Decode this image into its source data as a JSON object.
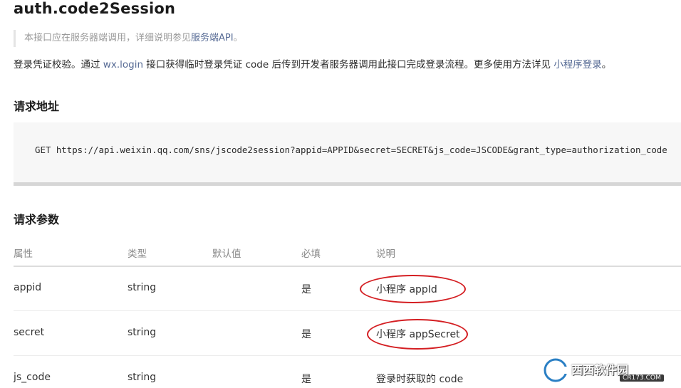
{
  "title": "auth.code2Session",
  "note": {
    "text": "本接口应在服务器端调用，详细说明参见",
    "link": "服务端API",
    "suffix": "。"
  },
  "intro": {
    "p1": "登录凭证校验。通过 ",
    "link1": "wx.login",
    "p2": " 接口获得临时登录凭证 code 后传到开发者服务器调用此接口完成登录流程。更多使用方法详见 ",
    "link2": "小程序登录",
    "p3": "。"
  },
  "section_request_url": "请求地址",
  "request_url": "GET https://api.weixin.qq.com/sns/jscode2session?appid=APPID&secret=SECRET&js_code=JSCODE&grant_type=authorization_code",
  "section_params": "请求参数",
  "table": {
    "headers": [
      "属性",
      "类型",
      "默认值",
      "必填",
      "说明"
    ],
    "rows": [
      {
        "name": "appid",
        "type": "string",
        "default": "",
        "required": "是",
        "desc": "小程序 appId"
      },
      {
        "name": "secret",
        "type": "string",
        "default": "",
        "required": "是",
        "desc": "小程序 appSecret"
      },
      {
        "name": "js_code",
        "type": "string",
        "default": "",
        "required": "是",
        "desc": "登录时获取的 code"
      }
    ]
  },
  "watermark": {
    "brand": "西西软件园",
    "site": "CR173.COM"
  },
  "colors": {
    "link": "#576b95",
    "annotation": "#d41e22",
    "code_bg": "#f7f7f7"
  }
}
